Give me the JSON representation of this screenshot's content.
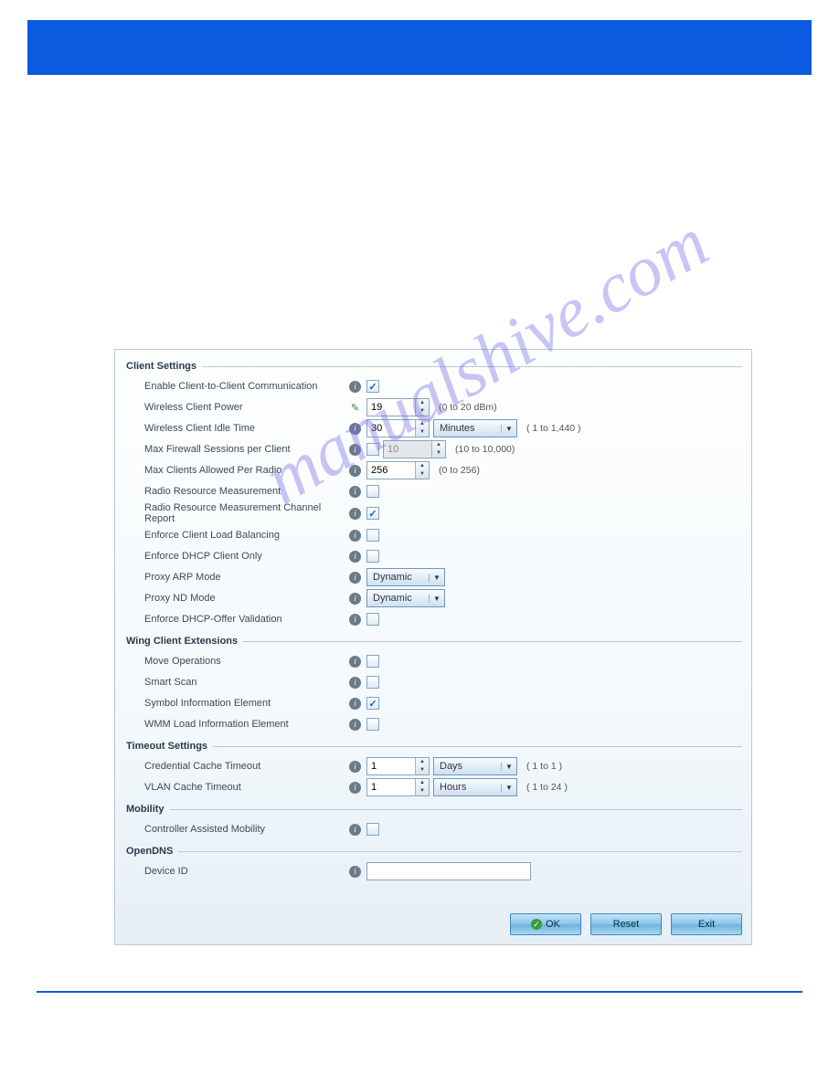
{
  "watermark": "manualshive.com",
  "sections": {
    "client": {
      "legend": "Client Settings",
      "enable_c2c": {
        "label": "Enable Client-to-Client Communication",
        "checked": true
      },
      "client_power": {
        "label": "Wireless Client Power",
        "value": "19",
        "hint": "(0 to 20 dBm)"
      },
      "idle_time": {
        "label": "Wireless Client Idle Time",
        "value": "30",
        "unit": "Minutes",
        "hint": "( 1 to 1,440 )"
      },
      "max_fw": {
        "label": "Max Firewall Sessions per Client",
        "enabled": false,
        "value": "10",
        "hint": "(10 to 10,000)"
      },
      "max_clients": {
        "label": "Max Clients Allowed Per Radio",
        "value": "256",
        "hint": "(0 to 256)"
      },
      "rrm": {
        "label": "Radio Resource Measurement",
        "checked": false
      },
      "rrm_cr": {
        "label": "Radio Resource Measurement Channel Report",
        "checked": true
      },
      "enforce_lb": {
        "label": "Enforce Client Load Balancing",
        "checked": false
      },
      "enforce_dhcp": {
        "label": "Enforce DHCP Client Only",
        "checked": false
      },
      "proxy_arp": {
        "label": "Proxy ARP Mode",
        "value": "Dynamic"
      },
      "proxy_nd": {
        "label": "Proxy ND Mode",
        "value": "Dynamic"
      },
      "enforce_dhcp_offer": {
        "label": "Enforce DHCP-Offer Validation",
        "checked": false
      }
    },
    "wing": {
      "legend": "Wing Client Extensions",
      "move": {
        "label": "Move Operations",
        "checked": false
      },
      "smart": {
        "label": "Smart Scan",
        "checked": false
      },
      "sie": {
        "label": "Symbol Information Element",
        "checked": true
      },
      "wmm": {
        "label": "WMM Load Information Element",
        "checked": false
      }
    },
    "timeout": {
      "legend": "Timeout Settings",
      "cred": {
        "label": "Credential Cache Timeout",
        "value": "1",
        "unit": "Days",
        "hint": "( 1 to 1 )"
      },
      "vlan": {
        "label": "VLAN Cache Timeout",
        "value": "1",
        "unit": "Hours",
        "hint": "( 1 to 24 )"
      }
    },
    "mobility": {
      "legend": "Mobility",
      "cam": {
        "label": "Controller Assisted Mobility",
        "checked": false
      }
    },
    "opendns": {
      "legend": "OpenDNS",
      "devid": {
        "label": "Device ID",
        "value": ""
      }
    }
  },
  "buttons": {
    "ok": "OK",
    "reset": "Reset",
    "exit": "Exit"
  }
}
